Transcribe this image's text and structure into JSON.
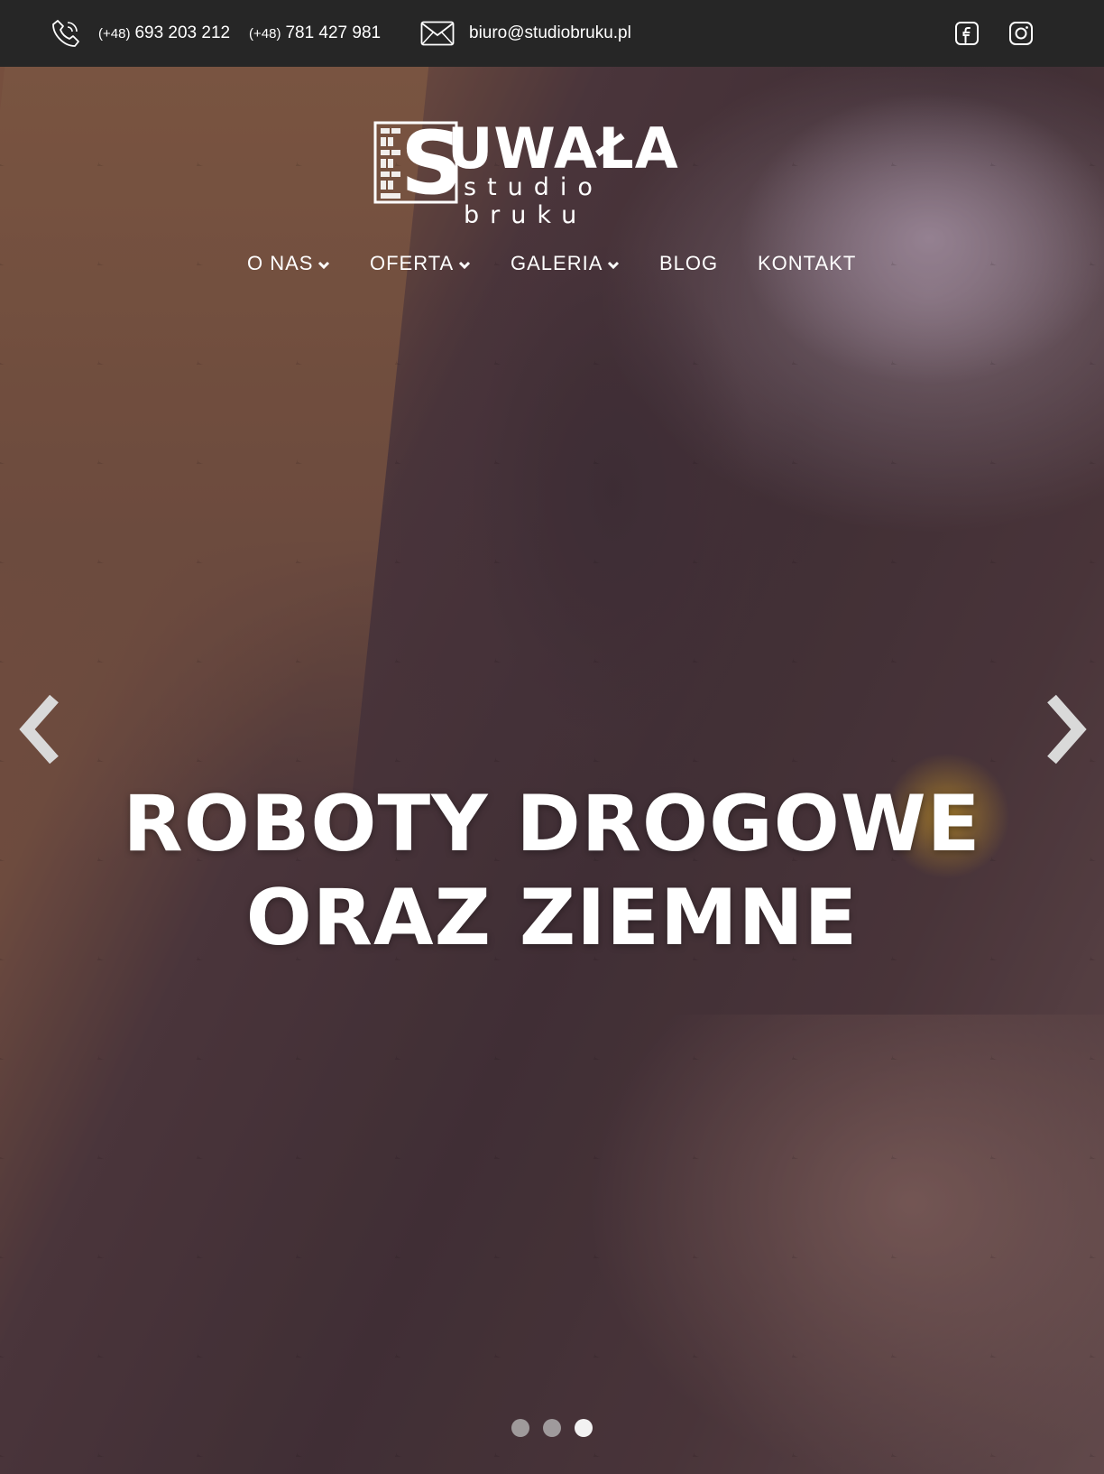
{
  "topbar": {
    "phone1": {
      "prefix": "(+48)",
      "number": "693 203 212"
    },
    "phone2": {
      "prefix": "(+48)",
      "number": "781 427 981"
    },
    "email": "biuro@studiobruku.pl",
    "icons": [
      "phone-icon",
      "mail-icon",
      "facebook-icon",
      "instagram-icon"
    ]
  },
  "logo": {
    "brand": "UWAŁA",
    "subtitle": "studio bruku"
  },
  "nav": {
    "items": [
      {
        "label": "O NAS",
        "has_dropdown": true
      },
      {
        "label": "OFERTA",
        "has_dropdown": true
      },
      {
        "label": "GALERIA",
        "has_dropdown": true
      },
      {
        "label": "BLOG",
        "has_dropdown": false
      },
      {
        "label": "KONTAKT",
        "has_dropdown": false
      }
    ]
  },
  "hero": {
    "headline_line1": "ROBOTY DROGOWE",
    "headline_line2": "ORAZ ZIEMNE",
    "slides_total": 3,
    "active_slide": 3
  },
  "colors": {
    "topbar_bg": "#262626",
    "text": "#ffffff",
    "dot_inactive": "#bebebe",
    "dot_active": "#f2f2f2"
  }
}
